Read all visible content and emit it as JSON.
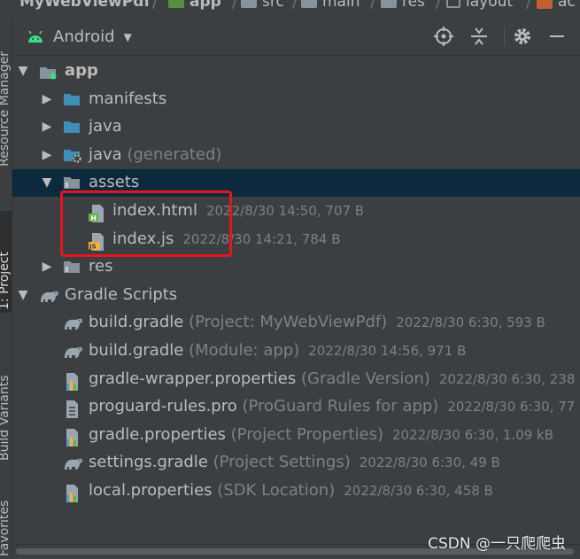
{
  "breadcrumb": {
    "items": [
      {
        "label": "MyWebViewPdf",
        "bold": true
      },
      {
        "label": "app",
        "bold": true
      },
      {
        "label": "src"
      },
      {
        "label": "main"
      },
      {
        "label": "res"
      },
      {
        "label": "layout"
      },
      {
        "label": "ac"
      }
    ]
  },
  "left_tabs": [
    {
      "label": "Resource Manager"
    },
    {
      "label": "1: Project",
      "active": true
    },
    {
      "label": "Build Variants"
    },
    {
      "label": "Favorites"
    }
  ],
  "toolbar": {
    "view_label": "Android",
    "buttons": [
      "locate-icon",
      "collapse-all-icon",
      "gear-icon",
      "minimize-icon"
    ]
  },
  "tree": [
    {
      "name": "app",
      "bold": true,
      "hint": "",
      "meta": "",
      "indent": 0,
      "toggle": "expanded",
      "icon": "module"
    },
    {
      "name": "manifests",
      "hint": "",
      "meta": "",
      "indent": 1,
      "toggle": "collapsed",
      "icon": "folder-blue"
    },
    {
      "name": "java",
      "hint": "",
      "meta": "",
      "indent": 1,
      "toggle": "collapsed",
      "icon": "folder-blue"
    },
    {
      "name": "java",
      "hint": " (generated)",
      "meta": "",
      "indent": 1,
      "toggle": "collapsed",
      "icon": "folder-generated"
    },
    {
      "name": "assets",
      "hint": "",
      "meta": "",
      "indent": 1,
      "toggle": "expanded",
      "icon": "folder-res",
      "selected": true
    },
    {
      "name": "index.html",
      "hint": "",
      "meta": "2022/8/30 14:50, 707 B",
      "indent": 2,
      "toggle": "none",
      "icon": "file-html"
    },
    {
      "name": "index.js",
      "hint": "",
      "meta": "2022/8/30 14:21, 784 B",
      "indent": 2,
      "toggle": "none",
      "icon": "file-js"
    },
    {
      "name": "res",
      "hint": "",
      "meta": "",
      "indent": 1,
      "toggle": "collapsed",
      "icon": "folder-res"
    },
    {
      "name": "Gradle Scripts",
      "hint": "",
      "meta": "",
      "indent": 0,
      "toggle": "expanded",
      "icon": "gradle"
    },
    {
      "name": "build.gradle",
      "hint": " (Project: MyWebViewPdf)",
      "meta": "2022/8/30 6:30, 593 B",
      "indent": 1,
      "toggle": "none",
      "icon": "gradle"
    },
    {
      "name": "build.gradle",
      "hint": " (Module: app)",
      "meta": "2022/8/30 14:56, 971 B",
      "indent": 1,
      "toggle": "none",
      "icon": "gradle"
    },
    {
      "name": "gradle-wrapper.properties",
      "hint": " (Gradle Version)",
      "meta": "2022/8/30 6:30, 238",
      "indent": 1,
      "toggle": "none",
      "icon": "properties"
    },
    {
      "name": "proguard-rules.pro",
      "hint": " (ProGuard Rules for app)",
      "meta": "2022/8/30 6:30, 77",
      "indent": 1,
      "toggle": "none",
      "icon": "text-file"
    },
    {
      "name": "gradle.properties",
      "hint": " (Project Properties)",
      "meta": "2022/8/30 6:30, 1.09 kB",
      "indent": 1,
      "toggle": "none",
      "icon": "properties"
    },
    {
      "name": "settings.gradle",
      "hint": " (Project Settings)",
      "meta": "2022/8/30 6:30, 49 B",
      "indent": 1,
      "toggle": "none",
      "icon": "gradle"
    },
    {
      "name": "local.properties",
      "hint": " (SDK Location)",
      "meta": "2022/8/30 6:30, 458 B",
      "indent": 1,
      "toggle": "none",
      "icon": "properties"
    }
  ],
  "watermark": "CSDN @一只爬爬虫",
  "colors": {
    "background": "#3c3f41",
    "selection": "#0d293e",
    "text": "#bbbbbb",
    "hint": "#808080",
    "highlight_box": "#e8141b",
    "folder_blue": "#3d8fb8",
    "android_green": "#3ddc84"
  }
}
